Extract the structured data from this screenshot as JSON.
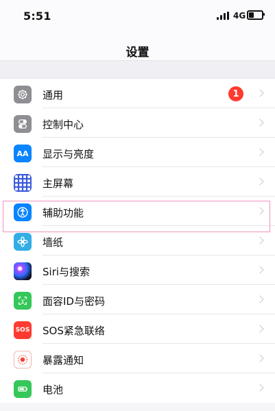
{
  "status_bar": {
    "time": "5:51",
    "network": "4G",
    "battery_level": 0.45,
    "signal_icon": "signal-bars-icon",
    "battery_icon": "battery-icon"
  },
  "header": {
    "title": "设置"
  },
  "settings": {
    "items": [
      {
        "label": "通用",
        "icon": "gear-icon",
        "badge": "1",
        "icon_color": "#8e8e93"
      },
      {
        "label": "控制中心",
        "icon": "control-center-icon",
        "icon_color": "#8e8e93"
      },
      {
        "label": "显示与亮度",
        "icon": "aa-icon",
        "icon_text": "AA",
        "icon_color": "#0a84ff"
      },
      {
        "label": "主屏幕",
        "icon": "home-screen-icon",
        "icon_color": "#3b5bdb"
      },
      {
        "label": "辅助功能",
        "icon": "accessibility-icon",
        "icon_color": "#0a84ff"
      },
      {
        "label": "墙纸",
        "icon": "flower-icon",
        "icon_color": "#32ade6"
      },
      {
        "label": "Siri与搜索",
        "icon": "siri-icon",
        "icon_color": "#6a4cff"
      },
      {
        "label": "面容ID与密码",
        "icon": "face-id-icon",
        "icon_color": "#34c759"
      },
      {
        "label": "SOS紧急联络",
        "icon": "sos-icon",
        "icon_text": "SOS",
        "icon_color": "#ff3b30"
      },
      {
        "label": "暴露通知",
        "icon": "exposure-icon",
        "icon_color": "#ff3b30"
      },
      {
        "label": "电池",
        "icon": "battery-setting-icon",
        "icon_color": "#34c759"
      }
    ]
  },
  "colors": {
    "highlight": "#f090be",
    "badge": "#ff3b30",
    "separator": "#e6e6ea",
    "background": "#f5f5f7"
  }
}
